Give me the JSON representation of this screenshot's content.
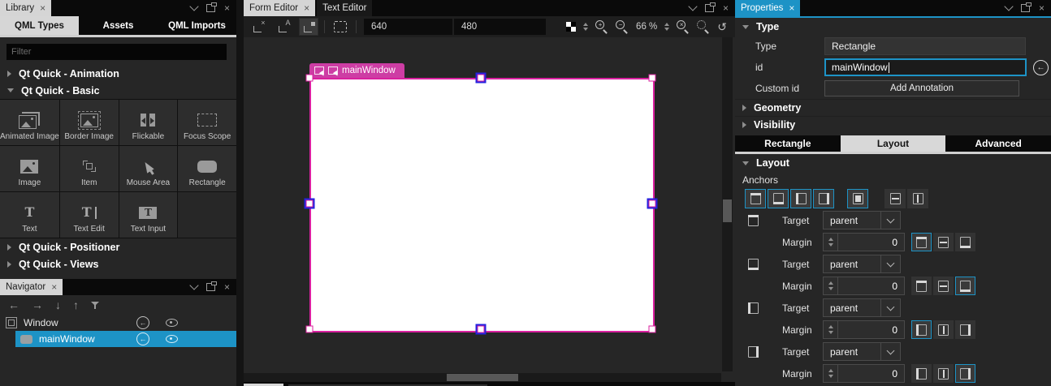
{
  "icons": {
    "close": "×",
    "back_arrow": "←",
    "nav_left": "←",
    "nav_right": "→",
    "nav_down": "↓",
    "nav_up": "↑",
    "undo": "↺",
    "zoom_in": "+",
    "zoom_out": "−",
    "zoom_reset": "×"
  },
  "library": {
    "title": "Library",
    "tabs": [
      {
        "label": "QML Types"
      },
      {
        "label": "Assets"
      },
      {
        "label": "QML Imports"
      }
    ],
    "filter_placeholder": "Filter",
    "sections_top": [
      {
        "label": "Qt Quick - Animation"
      },
      {
        "label": "Qt Quick - Basic"
      }
    ],
    "sections_bottom": [
      {
        "label": "Qt Quick - Positioner"
      },
      {
        "label": "Qt Quick - Views"
      }
    ],
    "items": [
      "Animated Image",
      "Border Image",
      "Flickable",
      "Focus Scope",
      "Image",
      "Item",
      "Mouse Area",
      "Rectangle",
      "Text",
      "Text Edit",
      "Text Input"
    ]
  },
  "navigator": {
    "title": "Navigator",
    "rows": [
      {
        "label": "Window"
      },
      {
        "label": "mainWindow"
      }
    ]
  },
  "editor": {
    "tabs": [
      {
        "label": "Form Editor"
      },
      {
        "label": "Text Editor"
      }
    ],
    "override_width": "640",
    "override_height": "480",
    "zoom_level": "66 %",
    "selected_item_label": "mainWindow"
  },
  "properties": {
    "title": "Properties",
    "sections": {
      "type": "Type",
      "geometry": "Geometry",
      "visibility": "Visibility",
      "layout": "Layout"
    },
    "type_row": {
      "label": "Type",
      "value": "Rectangle"
    },
    "id_row": {
      "label": "id",
      "value": "mainWindow"
    },
    "custom_id_row": {
      "label": "Custom id",
      "button": "Add Annotation"
    },
    "subtabs": [
      {
        "label": "Rectangle"
      },
      {
        "label": "Layout"
      },
      {
        "label": "Advanced"
      }
    ],
    "anchors_label": "Anchors",
    "target_label": "Target",
    "margin_label": "Margin",
    "anchor_rows": [
      {
        "side": "top",
        "target": "parent",
        "margin": "0"
      },
      {
        "side": "bottom",
        "target": "parent",
        "margin": "0"
      },
      {
        "side": "left",
        "target": "parent",
        "margin": "0"
      },
      {
        "side": "right",
        "target": "parent",
        "margin": "0"
      }
    ]
  },
  "colors": {
    "accent_cyan": "#1d93c6",
    "selection_pink": "#cd3da4",
    "selected_rect": "#ffffff"
  }
}
